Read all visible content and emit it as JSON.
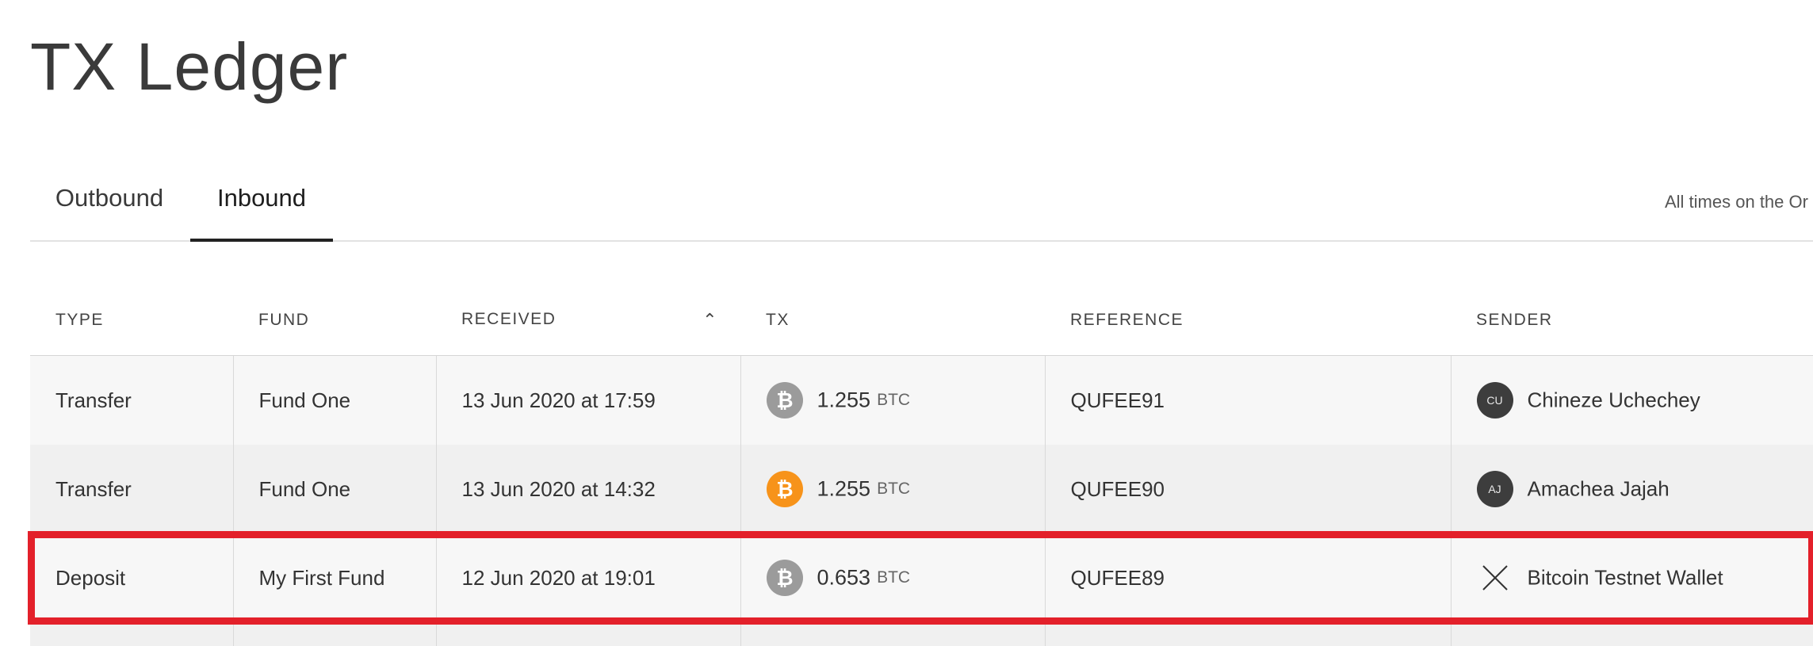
{
  "page": {
    "title": "TX Ledger"
  },
  "tabs": [
    {
      "label": "Outbound",
      "active": false
    },
    {
      "label": "Inbound",
      "active": true
    }
  ],
  "timezone_note": "All times on the Or",
  "table": {
    "columns": [
      "TYPE",
      "FUND",
      "RECEIVED",
      "TX",
      "REFERENCE",
      "SENDER"
    ],
    "sorted_column": "RECEIVED",
    "sort_direction": "ascending",
    "rows": [
      {
        "type": "Transfer",
        "fund": "Fund One",
        "received": "13 Jun 2020 at 17:59",
        "coin_icon": "bitcoin-icon",
        "coin_color": "#9b9b9b",
        "amount": "1.255",
        "unit": "BTC",
        "reference": "QUFEE91",
        "sender_initials": "CU",
        "sender": "Chineze Uchechey"
      },
      {
        "type": "Transfer",
        "fund": "Fund One",
        "received": "13 Jun 2020 at 14:32",
        "coin_icon": "bitcoin-icon",
        "coin_color": "#f7931a",
        "amount": "1.255",
        "unit": "BTC",
        "reference": "QUFEE90",
        "sender_initials": "AJ",
        "sender": "Amachea Jajah"
      },
      {
        "type": "Deposit",
        "fund": "My First Fund",
        "received": "12 Jun 2020 at 19:01",
        "coin_icon": "bitcoin-icon",
        "coin_color": "#9b9b9b",
        "amount": "0.653",
        "unit": "BTC",
        "reference": "QUFEE89",
        "sender_icon": "close-x-icon",
        "sender": "Bitcoin Testnet Wallet"
      }
    ]
  },
  "colors": {
    "highlight": "#e3202a",
    "bitcoin_orange": "#f7931a",
    "bitcoin_gray": "#9b9b9b"
  }
}
